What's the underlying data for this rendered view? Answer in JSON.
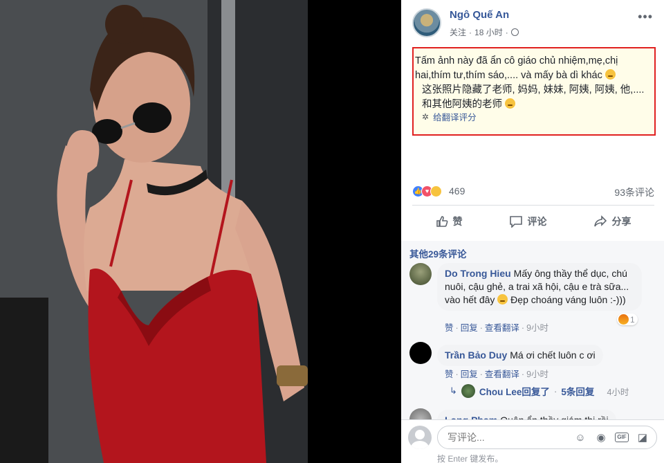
{
  "post": {
    "author": "Ngô Quế An",
    "follow": "关注",
    "time": "18 小时",
    "text_original": "Tấm ảnh này đã ẩn cô giáo chủ nhiệm,mẹ,chị hai,thím tư,thím sáo,.... và mấy bà dì khác",
    "text_translated": "这张照片隐藏了老师, 妈妈, 妹妹, 阿姨, 阿姨, 他,.... 和其他阿姨的老师",
    "rate_translation": "给翻译评分",
    "reaction_count": "469",
    "comment_count": "93条评论"
  },
  "actions": {
    "like": "赞",
    "comment": "评论",
    "share": "分享"
  },
  "comments": {
    "more_label": "其他29条评论",
    "items": [
      {
        "name": "Do Trong Hieu",
        "text": "Mấy ông thầy thể dục, chú nuôi, cậu ghẻ, a trai xã hội, cậu e trà sữa... vào hết đây",
        "text_tail": "Đẹp choáng váng luôn :-)))",
        "like": "赞",
        "reply": "回复",
        "translate": "查看翻译",
        "time": "9小时",
        "reaction_count": "1"
      },
      {
        "name": "Trần Bảo Duy",
        "text": "Má ơi chết luôn c ơi",
        "like": "赞",
        "reply": "回复",
        "translate": "查看翻译",
        "time": "9小时"
      }
    ],
    "reply_summary": {
      "text": "Chou Lee回复了",
      "count": "5条回复",
      "time": "4小时"
    },
    "partial": {
      "name": "Long Pham",
      "text": "Quên ẩn thầy giám thị rồi"
    }
  },
  "composer": {
    "placeholder": "写评论...",
    "hint": "按 Enter 键发布。"
  },
  "colors": {
    "link": "#385898",
    "highlight_border": "#e02020",
    "panel_bg": "#ffffff"
  }
}
